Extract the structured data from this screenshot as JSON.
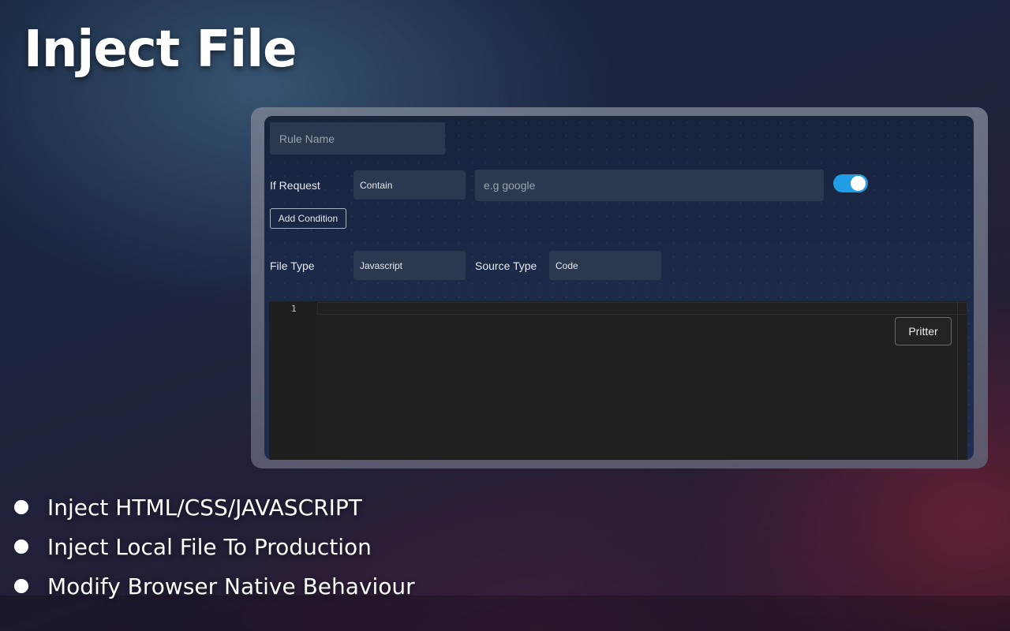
{
  "title": "Inject File",
  "form": {
    "rule_name_placeholder": "Rule Name",
    "if_request_label": "If Request",
    "condition_select_value": "Contain",
    "url_placeholder": "e.g google",
    "toggle_enabled": true,
    "add_condition_label": "Add Condition",
    "file_type_label": "File Type",
    "file_type_value": "Javascript",
    "source_type_label": "Source Type",
    "source_type_value": "Code"
  },
  "editor": {
    "line_number": "1",
    "format_button_label": "Pritter"
  },
  "features": [
    "Inject HTML/CSS/JAVASCRIPT",
    "Inject Local File To Production",
    "Modify Browser Native Behaviour"
  ],
  "colors": {
    "toggle_on": "#1f9ee6",
    "field_bg": "#2b3850",
    "editor_bg": "#202020"
  }
}
